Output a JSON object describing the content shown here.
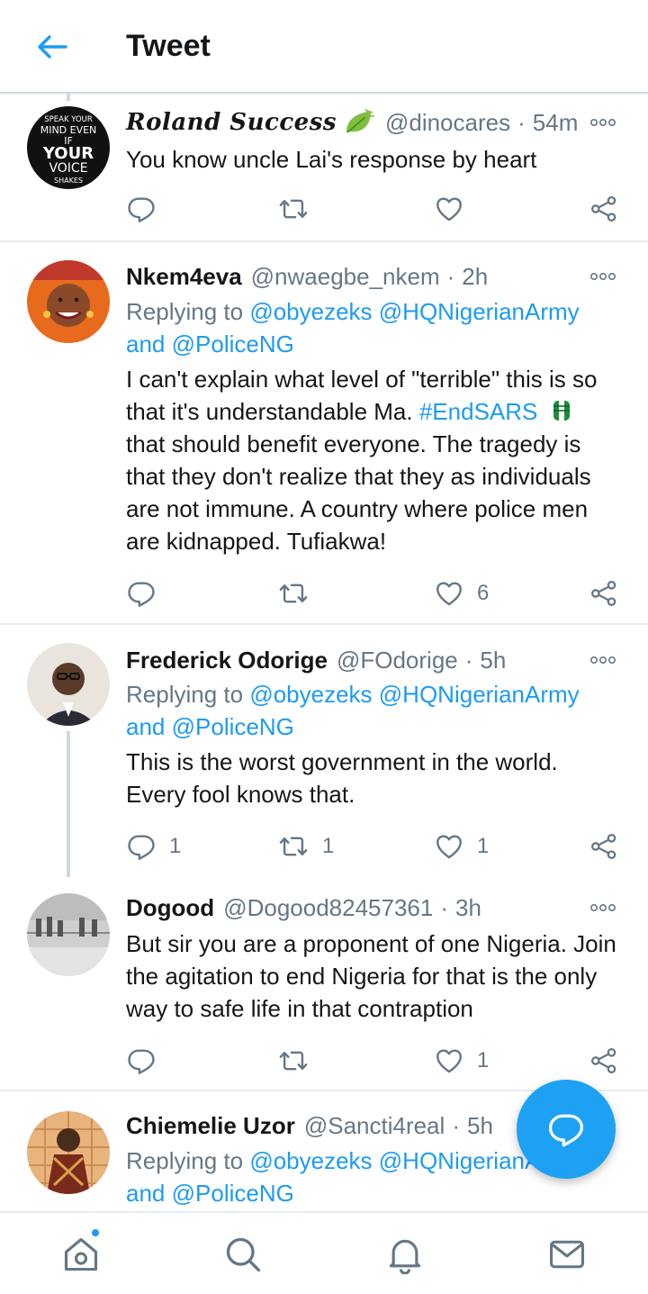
{
  "header": {
    "title": "Tweet",
    "back_icon": "arrow-left-icon"
  },
  "colors": {
    "accent": "#1d9bf0",
    "secondary_text": "#657786",
    "divider": "#e6ecf0"
  },
  "tweets": [
    {
      "name": "Roland Success",
      "handle": "@dinocares",
      "sep": "·",
      "time": "54m",
      "body": "You know uncle Lai's response by heart",
      "avatar_text": [
        "SPEAK YOUR",
        "MIND EVEN",
        "IF",
        "YOUR",
        "VOICE",
        "SHAKES"
      ],
      "counts": {
        "reply": "",
        "retweet": "",
        "like": ""
      }
    },
    {
      "name": "Nkem4eva",
      "handle": "@nwaegbe_nkem",
      "sep": "·",
      "time": "2h",
      "replying_prefix": "Replying to",
      "mention1": "@obyezeks",
      "mention2": "@HQNigerianArmy",
      "and_text": "and",
      "mention3": "@PoliceNG",
      "body_part1": "I can't explain what level of \"terrible\" this is so that it's understandable Ma.",
      "hashtag": "#EndSARS",
      "body_part2": "that should benefit everyone. The tragedy is that they don't realize that they as individuals are not immune. A country where police men are kidnapped. Tufiakwa!",
      "counts": {
        "reply": "",
        "retweet": "",
        "like": "6"
      }
    },
    {
      "name": "Frederick Odorige",
      "handle": "@FOdorige",
      "sep": "·",
      "time": "5h",
      "replying_prefix": "Replying to",
      "mention1": "@obyezeks",
      "mention2": "@HQNigerianArmy",
      "and_text": "and",
      "mention3": "@PoliceNG",
      "body": "This is the worst government in the world. Every fool knows that.",
      "counts": {
        "reply": "1",
        "retweet": "1",
        "like": "1"
      }
    },
    {
      "name": "Dogood",
      "handle": "@Dogood82457361",
      "sep": "·",
      "time": "3h",
      "body": "But sir you are a proponent of one Nigeria. Join the agitation to end Nigeria for that is the only way to safe life in that contraption",
      "counts": {
        "reply": "",
        "retweet": "",
        "like": "1"
      }
    },
    {
      "name": "Chiemelie Uzor",
      "handle": "@Sancti4real",
      "sep": "·",
      "time": "5h",
      "replying_prefix": "Replying to",
      "mention1": "@obyezeks",
      "mention2": "@HQNigerianArmy",
      "and_text": "and",
      "mention3": "@PoliceNG"
    }
  ],
  "fab": {
    "icon": "compose-reply-icon"
  },
  "bottom_nav": [
    "home-icon",
    "search-icon",
    "bell-icon",
    "mail-icon"
  ]
}
